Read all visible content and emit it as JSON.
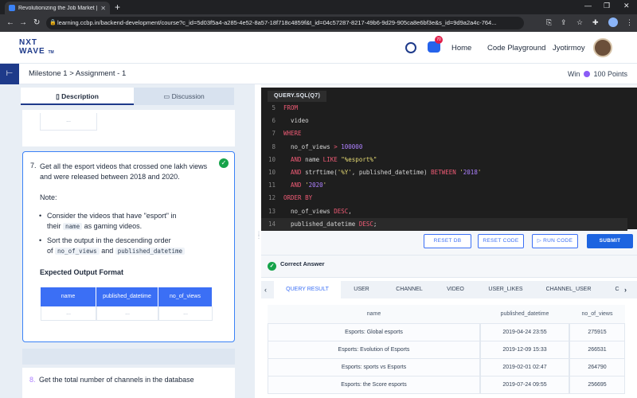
{
  "browser": {
    "tab_title": "Revolutionizing the Job Market | ",
    "url": "learning.ccbp.in/backend-development/course?c_id=5d03f5a4-a285-4e52-8a57-18f718c4859f&t_id=04c57287-8217-49b6-9d29-905ca8e6bf3e&s_id=9d9a2a4c-764..."
  },
  "header": {
    "logo_line1": "NXT",
    "logo_line2": "WAVE",
    "logo_tm": "TM",
    "chat_badge": "70",
    "home_label": "Home",
    "playground_label": "Code Playground",
    "user_name": "Jyotirmoy"
  },
  "subheader": {
    "breadcrumb": "Milestone 1 > Assignment - 1",
    "win_prefix": "Win",
    "win_points": "100 Points"
  },
  "left_tabs": {
    "description": "Description",
    "discussion": "Discussion"
  },
  "prev_table": {
    "cell": "..."
  },
  "question7": {
    "number": "7.",
    "text": "Get all the esport videos that crossed one lakh views and were released between 2018 and 2020.",
    "note_label": "Note:",
    "bullet1_part1": "Consider the videos that have \"esport\" in",
    "bullet1_part2": "their",
    "bullet1_code": "name",
    "bullet1_part3": "as gaming videos.",
    "bullet2_part1": "Sort the output in the descending order",
    "bullet2_part2": "of",
    "bullet2_code1": "no_of_views",
    "bullet2_and": "and",
    "bullet2_code2": "published_datetime",
    "expected_label": "Expected Output Format",
    "table_headers": [
      "name",
      "published_datetime",
      "no_of_views"
    ],
    "table_row": [
      "...",
      "...",
      "..."
    ]
  },
  "question8": {
    "number": "8.",
    "text": "Get the total number of channels in the database"
  },
  "editor": {
    "tab_label": "QUERY.SQL(Q7)",
    "lines": [
      {
        "n": "5",
        "t": "FROM"
      },
      {
        "n": "6",
        "t": "  video"
      },
      {
        "n": "7",
        "t": "WHERE"
      },
      {
        "n": "8",
        "t": "  no_of_views > 100000"
      },
      {
        "n": "10",
        "t": "  AND name LIKE \"%esport%\""
      },
      {
        "n": "10",
        "t": "  AND strftime('%Y', published_datetime) BETWEEN '2018'"
      },
      {
        "n": "11",
        "t": "  AND '2020'"
      },
      {
        "n": "12",
        "t": "ORDER BY"
      },
      {
        "n": "13",
        "t": "  no_of_views DESC,"
      },
      {
        "n": "14",
        "t": "  published_datetime DESC;"
      }
    ]
  },
  "toolbar": {
    "reset_db": "RESET DB",
    "reset_code": "RESET CODE",
    "run_code": "RUN CODE",
    "submit": "SUBMIT"
  },
  "result": {
    "status": "Correct Answer",
    "tabs": [
      "QUERY RESULT",
      "USER",
      "CHANNEL",
      "VIDEO",
      "USER_LIKES",
      "CHANNEL_USER",
      "C"
    ],
    "headers": [
      "name",
      "published_datetime",
      "no_of_views"
    ],
    "rows": [
      [
        "Esports: Global esports",
        "2019-04-24 23:55",
        "275915"
      ],
      [
        "Esports: Evolution of Esports",
        "2019-12-09 15:33",
        "266531"
      ],
      [
        "Esports: sports vs Esports",
        "2019-02-01 02:47",
        "264790"
      ],
      [
        "Esports: the Score esports",
        "2019-07-24 09:55",
        "256695"
      ]
    ]
  },
  "colors": {
    "brand": "#1e3a8a",
    "primary": "#3b6ff5",
    "submit": "#1d64e0",
    "success": "#16a34a",
    "editor_bg": "#1e1e1e"
  }
}
